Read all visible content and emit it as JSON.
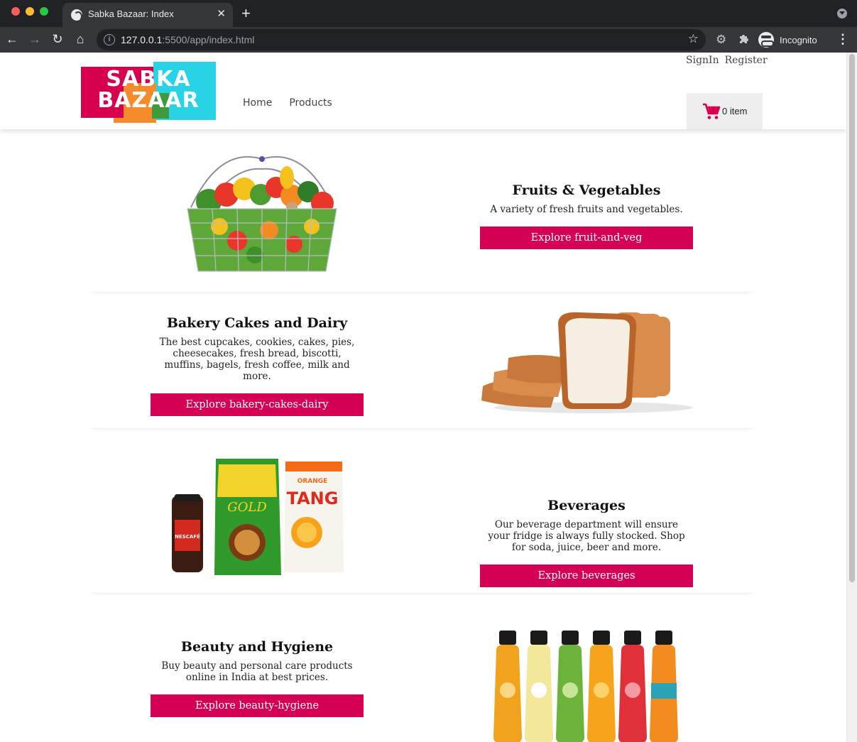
{
  "browser": {
    "tab_title": "Sabka Bazaar: Index",
    "tab_close": "✕",
    "new_tab": "+",
    "url_host": "127.0.0.1",
    "url_rest": ":5500/app/index.html",
    "profile_label": "Incognito",
    "icons": [
      "back-arrow-icon",
      "forward-arrow-icon",
      "reload-icon",
      "home-icon",
      "info-icon",
      "star-icon",
      "extension-gear-icon",
      "puzzle-icon",
      "incognito-icon",
      "menu-dots-icon"
    ]
  },
  "header": {
    "logo_line1": "SABKA",
    "logo_line2": "BAZAAR",
    "nav": {
      "home": "Home",
      "products": "Products"
    },
    "auth": {
      "signin": "SignIn",
      "register": "Register"
    },
    "cart": {
      "count_label": "0 item"
    },
    "colors": {
      "brand_pink": "#d6004f",
      "brand_cyan": "#27d3e4",
      "brand_orange": "#f68b2c",
      "brand_green": "#3f9a3c"
    }
  },
  "categories": [
    {
      "title": "Fruits & Vegetables",
      "description": "A variety of fresh fruits and vegetables.",
      "button": "Explore fruit-and-veg"
    },
    {
      "title": "Bakery Cakes and Dairy",
      "description": "The best cupcakes, cookies, cakes, pies, cheesecakes, fresh bread, biscotti, muffins, bagels, fresh coffee, milk and more.",
      "button": "Explore bakery-cakes-dairy"
    },
    {
      "title": "Beverages",
      "description": "Our beverage department will ensure your fridge is always fully stocked. Shop for soda, juice, beer and more.",
      "button": "Explore beverages"
    },
    {
      "title": "Beauty and Hygiene",
      "description": "Buy beauty and personal care products online in India at best prices.",
      "button": "Explore beauty-hygiene"
    }
  ],
  "product_labels": {
    "nescafe": "NESCAFÉ",
    "tata_gold": "GOLD",
    "tang": "TANG",
    "tang_flavor": "ORANGE"
  },
  "button_color": "#d30054"
}
